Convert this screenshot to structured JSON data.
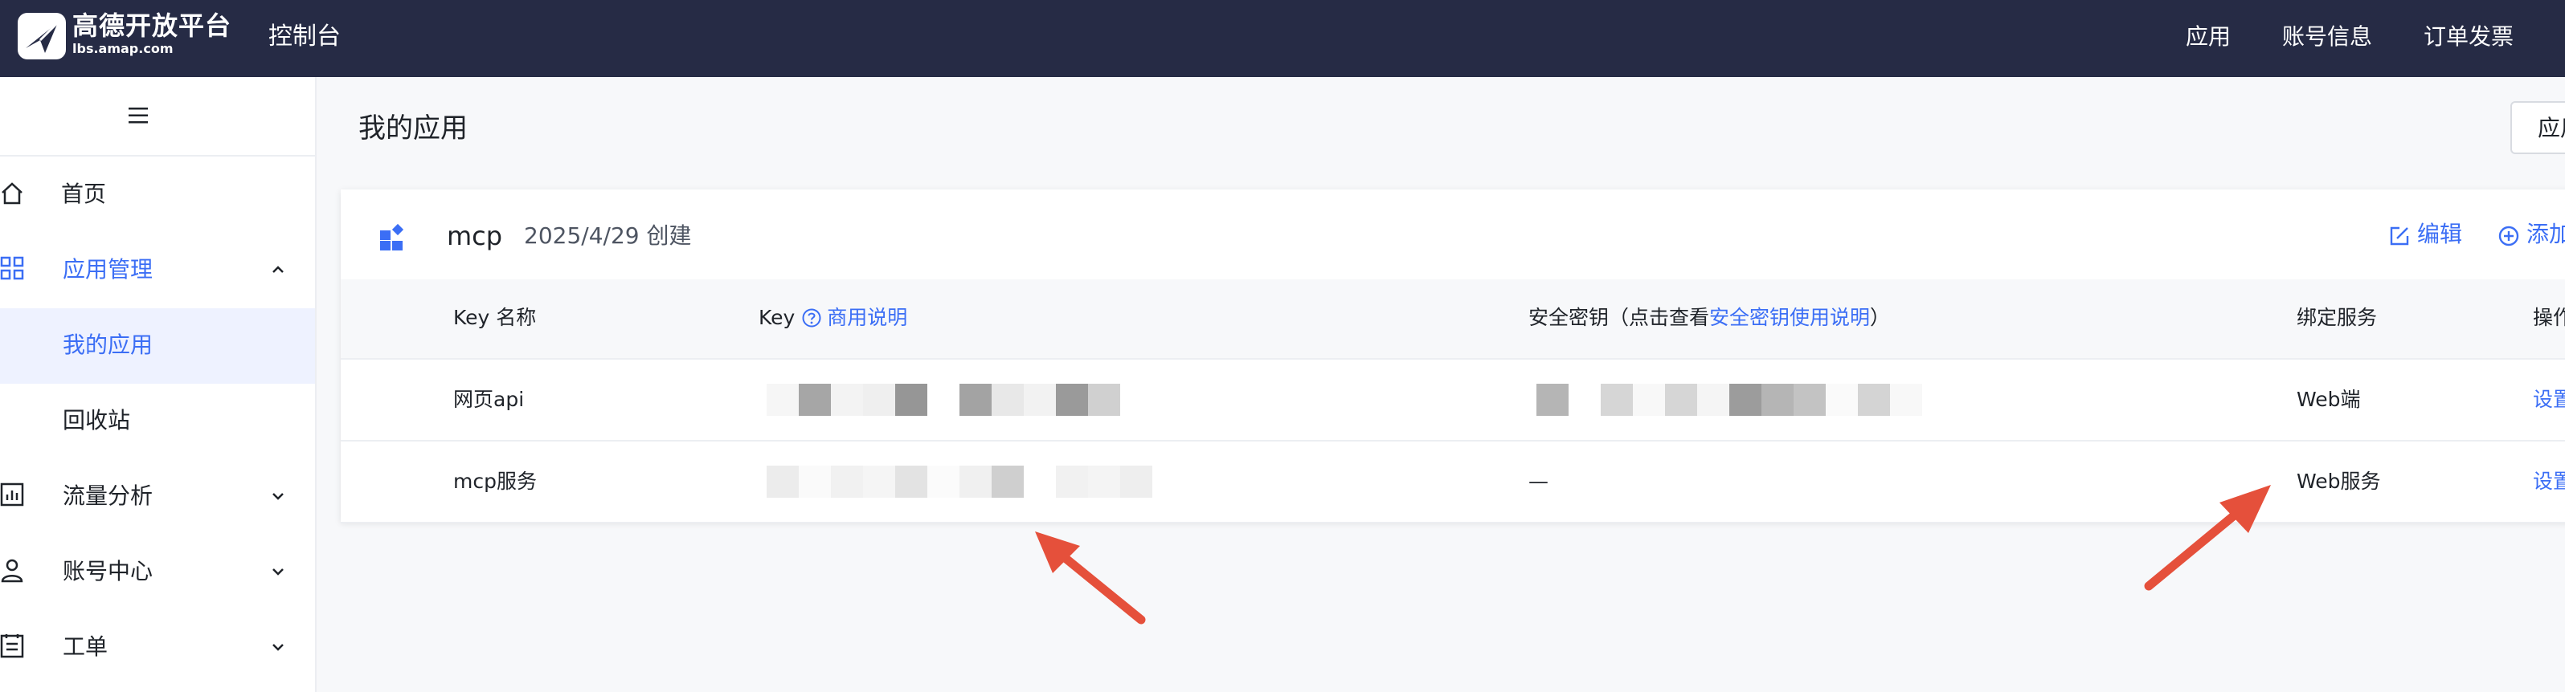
{
  "colors": {
    "topbar": "#262b45",
    "accent": "#3b6ef5",
    "annotation_arrow": "#e5503b",
    "page_bg": "#f7f8fa"
  },
  "topbar": {
    "brand_name": "高德开放平台",
    "brand_url": "lbs.amap.com",
    "section": "控制台",
    "nav": [
      "应用",
      "账号信息",
      "订单发票"
    ]
  },
  "sidebar": {
    "toggle_icon": "hamburger-icon",
    "items": [
      {
        "label": "首页",
        "icon": "home-icon"
      },
      {
        "label": "应用管理",
        "icon": "grid-icon",
        "expanded": true,
        "active": true
      },
      {
        "label": "我的应用",
        "sub": true,
        "selected": true
      },
      {
        "label": "回收站",
        "sub": true
      },
      {
        "label": "流量分析",
        "icon": "chart-icon",
        "expanded": false
      },
      {
        "label": "账号中心",
        "icon": "user-icon",
        "expanded": false
      },
      {
        "label": "工单",
        "icon": "ticket-icon",
        "expanded": false
      }
    ]
  },
  "main": {
    "title": "我的应用",
    "corner_button": "应用",
    "app": {
      "name": "mcp",
      "created": "2025/4/29 创建",
      "actions": {
        "edit": "编辑",
        "add": "添加"
      }
    },
    "table": {
      "headers": {
        "key_name": "Key 名称",
        "key": "Key",
        "key_help": "商用说明",
        "secret_prefix": "安全密钥（点击查看",
        "secret_link": "安全密钥使用说明",
        "secret_suffix": "）",
        "service": "绑定服务",
        "ops": "操作"
      },
      "rows": [
        {
          "key_name": "网页api",
          "key": "(masked)",
          "secret": "(masked)",
          "service": "Web端",
          "op": "设置"
        },
        {
          "key_name": "mcp服务",
          "key": "(masked)",
          "secret": "—",
          "service": "Web服务",
          "op": "设置"
        }
      ]
    }
  }
}
